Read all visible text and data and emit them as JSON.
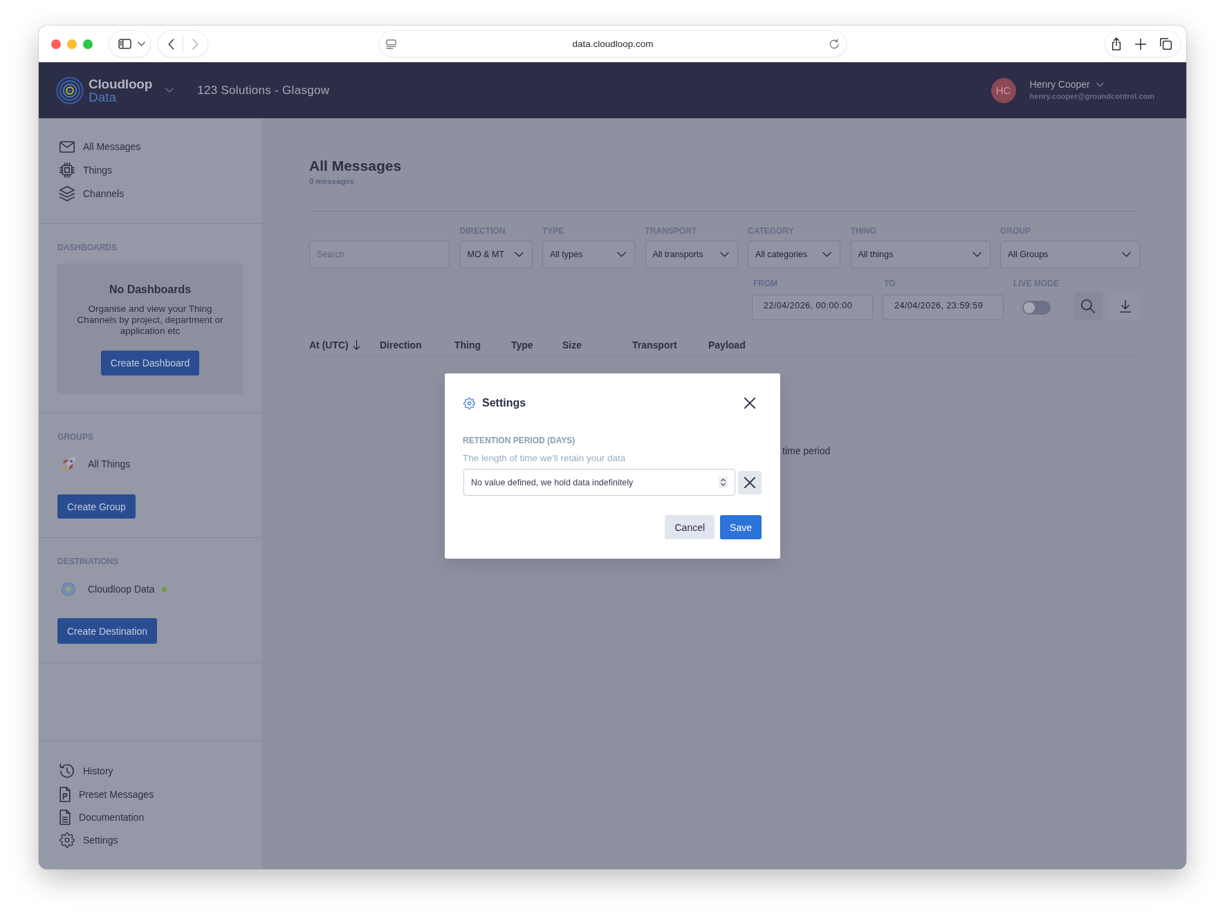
{
  "browser": {
    "back": {
      "disabled": false
    },
    "forward": {
      "disabled": true
    },
    "url": "data.cloudloop.com"
  },
  "header": {
    "brand": {
      "name": "Cloudloop",
      "product": "Data"
    },
    "organisation": "123 Solutions - Glasgow",
    "user": {
      "initials": "HC",
      "name": "Henry Cooper",
      "email": "henry.cooper@groundcontrol.com"
    }
  },
  "sidebar": {
    "nav": [
      {
        "label": "All Messages"
      },
      {
        "label": "Things"
      },
      {
        "label": "Channels"
      }
    ],
    "dashboards": {
      "title": "DASHBOARDS",
      "empty_title": "No Dashboards",
      "empty_text": "Organise and view your Thing Channels by project, department or application etc",
      "button": "Create Dashboard"
    },
    "groups": {
      "title": "GROUPS",
      "items": [
        {
          "label": "All Things"
        }
      ],
      "button": "Create Group"
    },
    "destinations": {
      "title": "DESTINATIONS",
      "items": [
        {
          "label": "Cloudloop Data",
          "color": "#6f9b3f"
        }
      ],
      "button": "Create Destination"
    },
    "footer_nav": [
      {
        "label": "History"
      },
      {
        "label": "Preset Messages"
      },
      {
        "label": "Documentation"
      },
      {
        "label": "Settings"
      }
    ]
  },
  "main": {
    "title": "All Messages",
    "count": "0 messages",
    "search": {
      "placeholder": "Search"
    },
    "filters": [
      {
        "label": "DIRECTION",
        "value": "MO & MT"
      },
      {
        "label": "TYPE",
        "value": "All types"
      },
      {
        "label": "TRANSPORT",
        "value": "All transports"
      },
      {
        "label": "CATEGORY",
        "value": "All categories"
      },
      {
        "label": "THING",
        "value": "All things"
      },
      {
        "label": "GROUP",
        "value": "All Groups"
      }
    ],
    "date_range": [
      {
        "label": "FROM",
        "value": "22/04/2026, 00:00:00"
      },
      {
        "label": "TO",
        "value": "24/04/2026, 23:59:59"
      }
    ],
    "live_mode": {
      "label": "LIVE MODE",
      "on": false
    },
    "table": {
      "columns": [
        {
          "label": "At (UTC)",
          "sorted": true
        },
        {
          "label": "Direction",
          "sorted": false
        },
        {
          "label": "Thing",
          "sorted": false
        },
        {
          "label": "Type",
          "sorted": false
        },
        {
          "label": "Size",
          "sorted": false
        },
        {
          "label": "Transport",
          "sorted": false
        },
        {
          "label": "Payload",
          "sorted": false
        }
      ]
    },
    "empty_state_text": "time period"
  },
  "modal": {
    "title": "Settings",
    "field": {
      "label": "RETENTION PERIOD (DAYS)",
      "description": "The length of time we'll retain your data",
      "value": "No value defined, we hold data indefinitely"
    },
    "buttons": [
      {
        "label": "Cancel",
        "kind": "secondary"
      },
      {
        "label": "Save",
        "kind": "primary"
      }
    ]
  }
}
